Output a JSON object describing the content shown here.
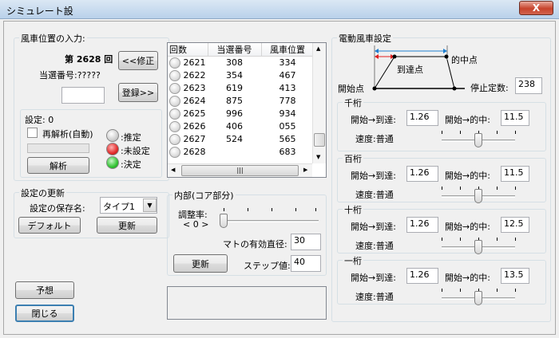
{
  "window": {
    "title": "シミュレート設",
    "close_label": "X"
  },
  "input_group": {
    "title": "風車位置の入力:",
    "round_text": "第 2628 回",
    "winning_number_text": "当選番号:?????",
    "number_input_value": "",
    "correct_button": "<<修正",
    "register_button": "登録>>",
    "setting_label": "設定: 0",
    "reanalysis_checkbox_label": "再解析(自動)",
    "analyze_button": "解析",
    "legend": [
      {
        "label": ":推定",
        "color": "#cfcfcf"
      },
      {
        "label": ":未設定",
        "color": "#e32b2b"
      },
      {
        "label": ":決定",
        "color": "#33c433"
      }
    ]
  },
  "history_table": {
    "columns": [
      "回数",
      "当選番号",
      "風車位置"
    ],
    "rows": [
      [
        "2621",
        "308",
        "334"
      ],
      [
        "2622",
        "354",
        "467"
      ],
      [
        "2623",
        "619",
        "413"
      ],
      [
        "2624",
        "875",
        "778"
      ],
      [
        "2625",
        "996",
        "934"
      ],
      [
        "2626",
        "406",
        "055"
      ],
      [
        "2627",
        "524",
        "565"
      ],
      [
        "2628",
        "",
        "683"
      ]
    ]
  },
  "update_group": {
    "title": "設定の更新",
    "save_name_label": "設定の保存名:",
    "save_name_value": "タイプ1",
    "default_button": "デフォルト",
    "update_button": "更新"
  },
  "inner_group": {
    "title": "内部(コア部分)",
    "adjust_label": "調整率:",
    "adjust_value": "< 0 >",
    "mato_diameter_label": "マトの有効直径:",
    "mato_diameter_value": "30",
    "step_label": "ステップ値:",
    "step_value": "40",
    "update_button": "更新"
  },
  "left_buttons": {
    "predict": "予想",
    "close": "閉じる"
  },
  "windmill_group": {
    "title": "電動風車設定",
    "diagram": {
      "reach": "到達点",
      "target": "的中点",
      "start": "開始点"
    },
    "stop_label": "停止定数:",
    "stop_value": "238",
    "sections": [
      {
        "title": "千桁",
        "start_reach_label": "開始→到達:",
        "start_reach": "1.26",
        "start_target_label": "開始→的中:",
        "start_target": "11.5",
        "speed_label": "速度:普通",
        "speed_level": 0.5
      },
      {
        "title": "百桁",
        "start_reach_label": "開始→到達:",
        "start_reach": "1.26",
        "start_target_label": "開始→的中:",
        "start_target": "11.5",
        "speed_label": "速度:普通",
        "speed_level": 0.5
      },
      {
        "title": "十桁",
        "start_reach_label": "開始→到達:",
        "start_reach": "1.26",
        "start_target_label": "開始→的中:",
        "start_target": "12.5",
        "speed_label": "速度:普通",
        "speed_level": 0.5
      },
      {
        "title": "一桁",
        "start_reach_label": "開始→到達:",
        "start_reach": "1.26",
        "start_target_label": "開始→的中:",
        "start_target": "13.5",
        "speed_label": "速度:普通",
        "speed_level": 0.5
      }
    ]
  }
}
